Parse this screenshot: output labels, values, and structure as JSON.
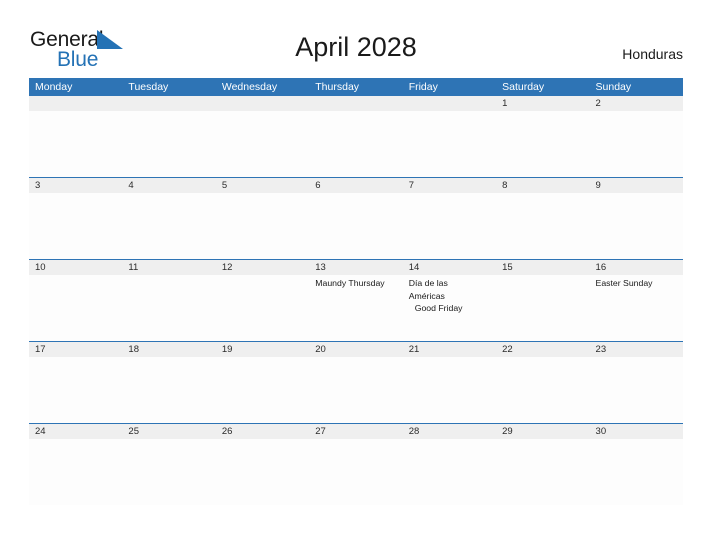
{
  "brand": {
    "name_top": "General",
    "name_bottom": "Blue",
    "flag_icon": "blue-flag-triangle",
    "accent_color": "#2472b5"
  },
  "header": {
    "title": "April 2028",
    "country": "Honduras"
  },
  "theme": {
    "header_blue": "#2e74b5",
    "date_band_gray": "#efefef",
    "cell_white": "#fdfdfd",
    "text_dark": "#1a1a1a"
  },
  "calendar": {
    "month": "April",
    "year": "2028",
    "day_headers": [
      "Monday",
      "Tuesday",
      "Wednesday",
      "Thursday",
      "Friday",
      "Saturday",
      "Sunday"
    ],
    "weeks": [
      {
        "days": [
          {
            "date": "",
            "events": []
          },
          {
            "date": "",
            "events": []
          },
          {
            "date": "",
            "events": []
          },
          {
            "date": "",
            "events": []
          },
          {
            "date": "",
            "events": []
          },
          {
            "date": "1",
            "events": []
          },
          {
            "date": "2",
            "events": []
          }
        ]
      },
      {
        "days": [
          {
            "date": "3",
            "events": []
          },
          {
            "date": "4",
            "events": []
          },
          {
            "date": "5",
            "events": []
          },
          {
            "date": "6",
            "events": []
          },
          {
            "date": "7",
            "events": []
          },
          {
            "date": "8",
            "events": []
          },
          {
            "date": "9",
            "events": []
          }
        ]
      },
      {
        "days": [
          {
            "date": "10",
            "events": []
          },
          {
            "date": "11",
            "events": []
          },
          {
            "date": "12",
            "events": []
          },
          {
            "date": "13",
            "events": [
              "Maundy Thursday"
            ]
          },
          {
            "date": "14",
            "events": [
              "Día de las",
              "Américas",
              " Good Friday"
            ]
          },
          {
            "date": "15",
            "events": []
          },
          {
            "date": "16",
            "events": [
              "Easter Sunday"
            ]
          }
        ]
      },
      {
        "days": [
          {
            "date": "17",
            "events": []
          },
          {
            "date": "18",
            "events": []
          },
          {
            "date": "19",
            "events": []
          },
          {
            "date": "20",
            "events": []
          },
          {
            "date": "21",
            "events": []
          },
          {
            "date": "22",
            "events": []
          },
          {
            "date": "23",
            "events": []
          }
        ]
      },
      {
        "days": [
          {
            "date": "24",
            "events": []
          },
          {
            "date": "25",
            "events": []
          },
          {
            "date": "26",
            "events": []
          },
          {
            "date": "27",
            "events": []
          },
          {
            "date": "28",
            "events": []
          },
          {
            "date": "29",
            "events": []
          },
          {
            "date": "30",
            "events": []
          }
        ]
      }
    ]
  }
}
